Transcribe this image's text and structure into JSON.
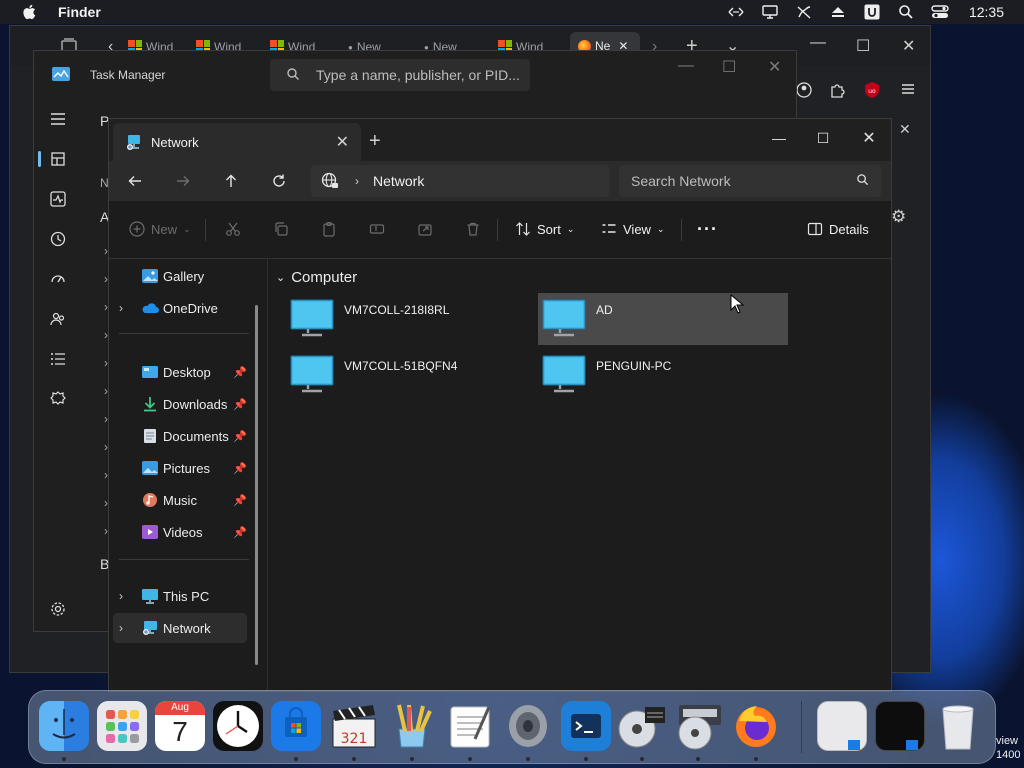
{
  "menubar": {
    "app_name": "Finder",
    "clock": "12:35"
  },
  "browser": {
    "tabs": [
      {
        "label": "Wind",
        "type": "windows"
      },
      {
        "label": "Wind",
        "type": "windows"
      },
      {
        "label": "Wind",
        "type": "windows"
      },
      {
        "label": "New",
        "type": "newtab"
      },
      {
        "label": "New",
        "type": "newtab"
      },
      {
        "label": "Wind",
        "type": "windows"
      },
      {
        "label": "Ne",
        "type": "firefox"
      }
    ]
  },
  "taskmgr": {
    "title": "Task Manager",
    "search_placeholder": "Type a name, publisher, or PID...",
    "partial_letters": {
      "p": "P",
      "n": "N",
      "a": "A",
      "b": "B"
    }
  },
  "explorer": {
    "tab_title": "Network",
    "address": "Network",
    "search_placeholder": "Search Network",
    "commands": {
      "new": "New",
      "sort": "Sort",
      "view": "View",
      "details": "Details"
    },
    "sidebar": {
      "gallery": "Gallery",
      "onedrive": "OneDrive",
      "desktop": "Desktop",
      "downloads": "Downloads",
      "documents": "Documents",
      "pictures": "Pictures",
      "music": "Music",
      "videos": "Videos",
      "thispc": "This PC",
      "network": "Network"
    },
    "group_header": "Computer",
    "computers": [
      {
        "name": "VM7COLL-218I8RL"
      },
      {
        "name": "AD"
      },
      {
        "name": "VM7COLL-51BQFN4"
      },
      {
        "name": "PENGUIN-PC"
      }
    ]
  },
  "dock": {
    "calendar_month": "Aug",
    "calendar_day": "7",
    "preview_label_line1": "view",
    "preview_label_line2": "1400"
  },
  "colors": {
    "accent": "#76b9ed",
    "monitor": "#3fb6e6",
    "selected_item": "#4a4a4a"
  }
}
